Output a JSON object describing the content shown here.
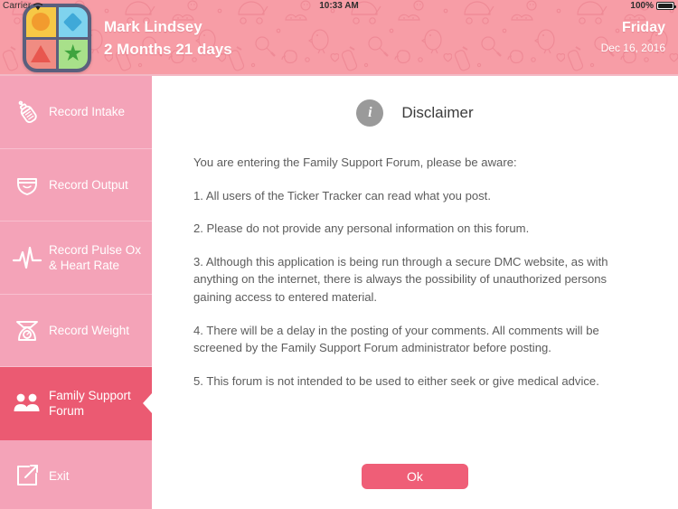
{
  "statusbar": {
    "carrier": "Carrier",
    "wifi_icon": "wifi-icon",
    "time": "10:33 AM",
    "battery_percent": "100%",
    "battery_icon": "battery-full-icon"
  },
  "header": {
    "app_icon": "app-logo-icon",
    "patient_name": "Mark Lindsey",
    "patient_age": "2 Months 21 days",
    "day_of_week": "Friday",
    "date": "Dec 16, 2016",
    "background_color": "#F79DA6"
  },
  "sidebar": {
    "background_color": "#F4A3B8",
    "active_color": "#EB5A72",
    "items": [
      {
        "label": "Record Intake",
        "icon": "baby-bottle-icon",
        "active": false
      },
      {
        "label": "Record Output",
        "icon": "diaper-icon",
        "active": false
      },
      {
        "label": "Record Pulse Ox & Heart Rate",
        "icon": "heartbeat-icon",
        "active": false
      },
      {
        "label": "Record Weight",
        "icon": "scale-icon",
        "active": false
      },
      {
        "label": "Family Support Forum",
        "icon": "people-icon",
        "active": true
      },
      {
        "label": "Exit",
        "icon": "exit-icon",
        "active": false
      }
    ]
  },
  "main": {
    "info_icon": "info-icon",
    "title": "Disclaimer",
    "paragraphs": [
      "You are entering the Family Support Forum, please be aware:",
      "1. All users of the Ticker Tracker can read what you post.",
      "2. Please do not provide any personal information on this forum.",
      "3. Although this application is being run through a secure DMC website, as with anything on the internet, there is always the possibility of unauthorized persons gaining access to entered material.",
      "4. There will be a delay in the posting of your comments. All comments will be screened by the Family Support Forum administrator before posting.",
      "5. This forum is not intended to be used to either seek or give medical advice."
    ],
    "ok_label": "Ok",
    "ok_color": "#EF5E77"
  }
}
